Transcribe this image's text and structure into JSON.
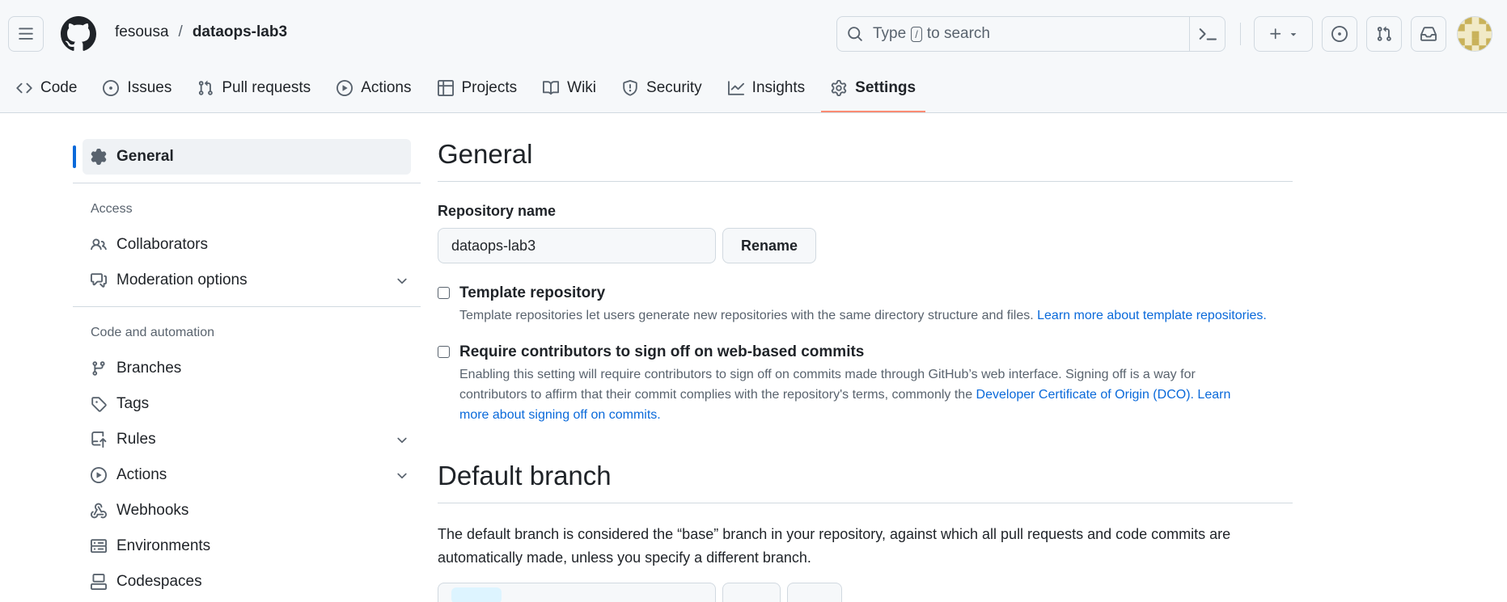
{
  "header": {
    "owner": "fesousa",
    "separator": "/",
    "repo": "dataops-lab3",
    "search": {
      "prefix": "Type",
      "key": "/",
      "suffix": "to search"
    }
  },
  "tabs": [
    {
      "label": "Code",
      "icon": "code-icon"
    },
    {
      "label": "Issues",
      "icon": "issue-opened-icon"
    },
    {
      "label": "Pull requests",
      "icon": "git-pull-request-icon"
    },
    {
      "label": "Actions",
      "icon": "play-icon"
    },
    {
      "label": "Projects",
      "icon": "table-icon"
    },
    {
      "label": "Wiki",
      "icon": "book-icon"
    },
    {
      "label": "Security",
      "icon": "shield-icon"
    },
    {
      "label": "Insights",
      "icon": "graph-icon"
    },
    {
      "label": "Settings",
      "icon": "gear-icon",
      "active": true
    }
  ],
  "sidebar": {
    "general": "General",
    "access_heading": "Access",
    "access_items": [
      {
        "label": "Collaborators",
        "icon": "people-icon"
      },
      {
        "label": "Moderation options",
        "icon": "comment-discussion-icon",
        "expandable": true
      }
    ],
    "automation_heading": "Code and automation",
    "automation_items": [
      {
        "label": "Branches",
        "icon": "git-branch-icon"
      },
      {
        "label": "Tags",
        "icon": "tag-icon"
      },
      {
        "label": "Rules",
        "icon": "repo-push-icon",
        "expandable": true
      },
      {
        "label": "Actions",
        "icon": "play-icon",
        "expandable": true
      },
      {
        "label": "Webhooks",
        "icon": "webhook-icon"
      },
      {
        "label": "Environments",
        "icon": "server-icon"
      },
      {
        "label": "Codespaces",
        "icon": "codespaces-icon"
      }
    ]
  },
  "main": {
    "title": "General",
    "repo_name_label": "Repository name",
    "repo_name_value": "dataops-lab3",
    "rename_button": "Rename",
    "template": {
      "title": "Template repository",
      "desc": "Template repositories let users generate new repositories with the same directory structure and files.",
      "link": "Learn more about template repositories."
    },
    "signoff": {
      "title": "Require contributors to sign off on web-based commits",
      "desc_line1": "Enabling this setting will require contributors to sign off on commits made through GitHub’s web interface. Signing off is a way for",
      "desc_line2": "contributors to affirm that their commit complies with the repository's terms, commonly the",
      "link_dco": "Developer Certificate of Origin (DCO).",
      "link_learn_1": "Learn",
      "link_learn_2": "more about signing off on commits."
    },
    "default_branch_title": "Default branch",
    "default_branch_desc": "The default branch is considered the “base” branch in your repository, against which all pull requests and code commits are automatically made, unless you specify a different branch."
  },
  "colors": {
    "accent": "#0969da",
    "tab_underline": "#fd8c73",
    "border": "#d1d9e0",
    "muted": "#59636e"
  }
}
